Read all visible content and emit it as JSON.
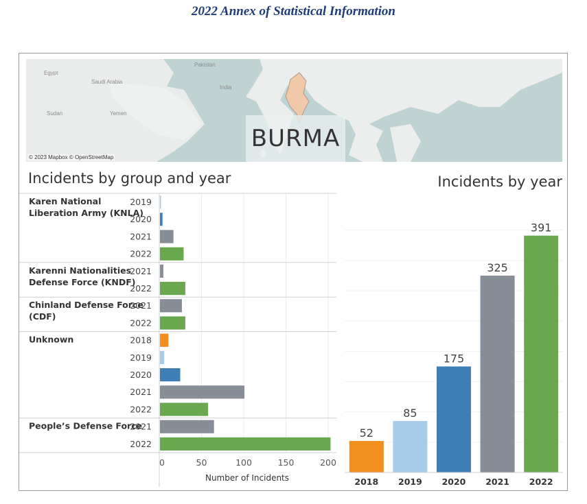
{
  "document": {
    "title": "2022 Annex of Statistical Information"
  },
  "map": {
    "labels": [
      "Egypt",
      "Saudi Arabia",
      "Pakistan",
      "India",
      "Sudan",
      "Yemen"
    ],
    "highlight_label": "BURMA",
    "credit": "© 2023 Mapbox © OpenStreetMap"
  },
  "charts": {
    "left_title": "Incidents by group and year",
    "right_title": "Incidents by year"
  },
  "colors": {
    "2018": "#f28e1c",
    "2019": "#a8cbe8",
    "2020": "#3f7fb8",
    "2021": "#878e97",
    "2022": "#6aa84f"
  },
  "chart_data": [
    {
      "type": "bar",
      "orientation": "horizontal",
      "title": "Incidents by group and year",
      "xlabel": "Number of Incidents",
      "xlim": [
        0,
        200
      ],
      "xticks": [
        0,
        50,
        100,
        150,
        200
      ],
      "groups": [
        {
          "name": "Karen National Liberation Army (KNLA)",
          "label_lines": [
            "Karen National",
            "Liberation Army (KNLA)"
          ],
          "bars": [
            {
              "year": "2019",
              "value": 1
            },
            {
              "year": "2020",
              "value": 3
            },
            {
              "year": "2021",
              "value": 16
            },
            {
              "year": "2022",
              "value": 28
            }
          ]
        },
        {
          "name": "Karenni Nationalities Defense Force (KNDF)",
          "label_lines": [
            "Karenni Nationalities",
            "Defense Force (KNDF)"
          ],
          "bars": [
            {
              "year": "2021",
              "value": 4
            },
            {
              "year": "2022",
              "value": 30
            }
          ]
        },
        {
          "name": "Chinland Defense Force (CDF)",
          "label_lines": [
            "Chinland Defense Force",
            "(CDF)"
          ],
          "bars": [
            {
              "year": "2021",
              "value": 26
            },
            {
              "year": "2022",
              "value": 30
            }
          ]
        },
        {
          "name": "Unknown",
          "label_lines": [
            "Unknown"
          ],
          "bars": [
            {
              "year": "2018",
              "value": 10
            },
            {
              "year": "2019",
              "value": 5
            },
            {
              "year": "2020",
              "value": 24
            },
            {
              "year": "2021",
              "value": 100
            },
            {
              "year": "2022",
              "value": 57
            }
          ]
        },
        {
          "name": "People's Defense Force",
          "label_lines": [
            "People’s Defense Force"
          ],
          "bars": [
            {
              "year": "2021",
              "value": 64
            },
            {
              "year": "2022",
              "value": 202
            }
          ]
        }
      ]
    },
    {
      "type": "bar",
      "orientation": "vertical",
      "title": "Incidents by year",
      "categories": [
        "2018",
        "2019",
        "2020",
        "2021",
        "2022"
      ],
      "values": [
        52,
        85,
        175,
        325,
        391
      ],
      "ylim": [
        0,
        420
      ],
      "data_labels": true
    }
  ]
}
